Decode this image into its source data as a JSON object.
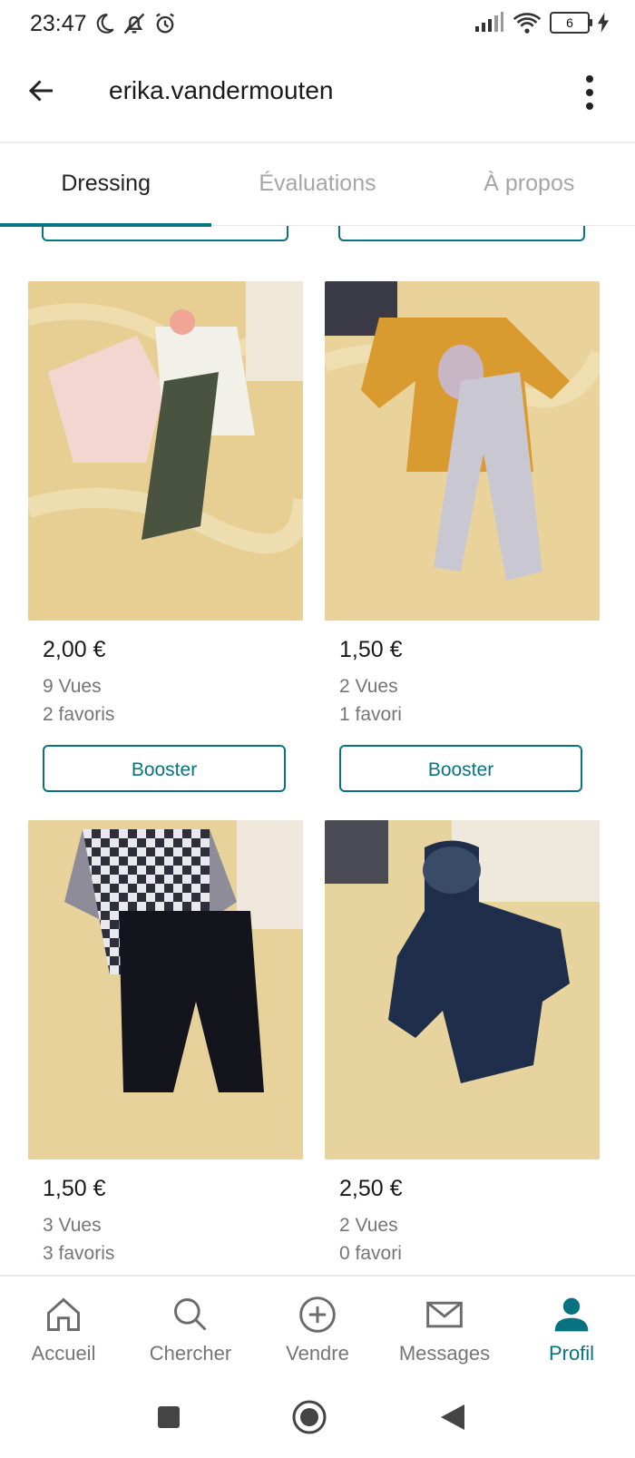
{
  "status_bar": {
    "time": "23:47",
    "battery": "6"
  },
  "header": {
    "username": "erika.vandermouten"
  },
  "tabs": [
    {
      "label": "Dressing",
      "active": true
    },
    {
      "label": "Évaluations",
      "active": false
    },
    {
      "label": "À propos",
      "active": false
    }
  ],
  "listings": [
    {
      "price": "2,00 €",
      "views": "9 Vues",
      "favorites": "2 favoris",
      "boost_label": "Booster"
    },
    {
      "price": "1,50 €",
      "views": "2 Vues",
      "favorites": "1 favori",
      "boost_label": "Booster"
    },
    {
      "price": "1,50 €",
      "views": "3 Vues",
      "favorites": "3 favoris"
    },
    {
      "price": "2,50 €",
      "views": "2 Vues",
      "favorites": "0 favori"
    }
  ],
  "bottom_nav": [
    {
      "label": "Accueil",
      "icon": "home-icon"
    },
    {
      "label": "Chercher",
      "icon": "search-icon"
    },
    {
      "label": "Vendre",
      "icon": "plus-circle-icon"
    },
    {
      "label": "Messages",
      "icon": "mail-icon"
    },
    {
      "label": "Profil",
      "icon": "profile-icon",
      "active": true
    }
  ],
  "colors": {
    "accent": "#087380",
    "muted_text": "#757575",
    "bed_fabric": "#e9d6a0"
  }
}
